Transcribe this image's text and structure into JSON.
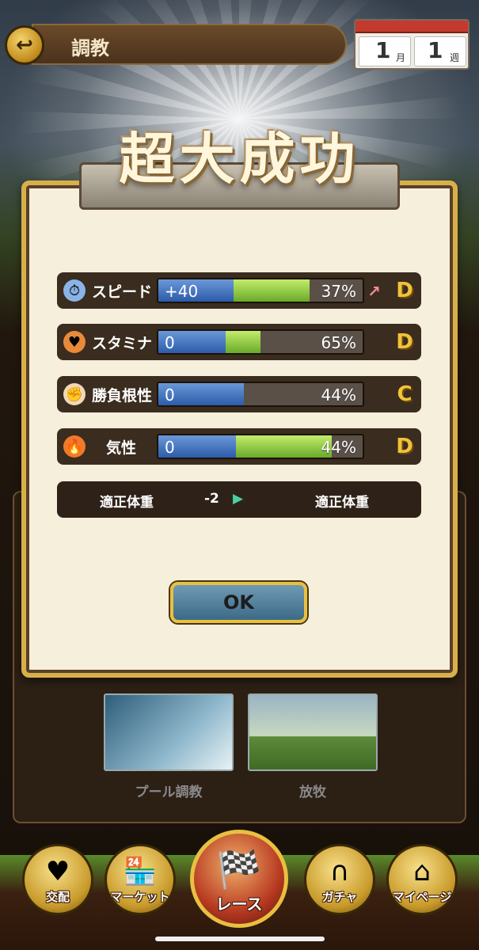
{
  "header": {
    "title": "調教",
    "calendar": {
      "month": "1",
      "month_unit": "月",
      "week": "1",
      "week_unit": "週"
    }
  },
  "result_banner": "超大成功",
  "stats": [
    {
      "label": "スピード",
      "gain": "+40",
      "percent": "37%",
      "fill": 0.37,
      "gain_fill": 0.37,
      "grade": "D",
      "icon": "stopwatch-icon",
      "up": true
    },
    {
      "label": "スタミナ",
      "gain": "0",
      "percent": "65%",
      "fill": 0.33,
      "gain_fill": 0.17,
      "grade": "D",
      "icon": "heart-icon",
      "up": false
    },
    {
      "label": "勝負根性",
      "gain": "0",
      "percent": "44%",
      "fill": 0.42,
      "gain_fill": 0.0,
      "grade": "C",
      "icon": "fist-icon",
      "up": false
    },
    {
      "label": "気性",
      "gain": "0",
      "percent": "44%",
      "fill": 0.38,
      "gain_fill": 0.47,
      "grade": "D",
      "icon": "flame-icon",
      "up": false
    }
  ],
  "weight": {
    "before": "適正体重",
    "change": "-2",
    "arrow": "▶",
    "after": "適正体重"
  },
  "ok_label": "OK",
  "training_options": [
    {
      "label": "プール調教"
    },
    {
      "label": "放牧"
    }
  ],
  "nav": [
    {
      "label": "交配",
      "icon": "breeding-icon"
    },
    {
      "label": "マーケット",
      "icon": "market-icon"
    },
    {
      "label": "レース",
      "icon": "checkered-flag-icon"
    },
    {
      "label": "ガチャ",
      "icon": "horseshoe-gacha-icon"
    },
    {
      "label": "マイページ",
      "icon": "house-icon"
    }
  ]
}
